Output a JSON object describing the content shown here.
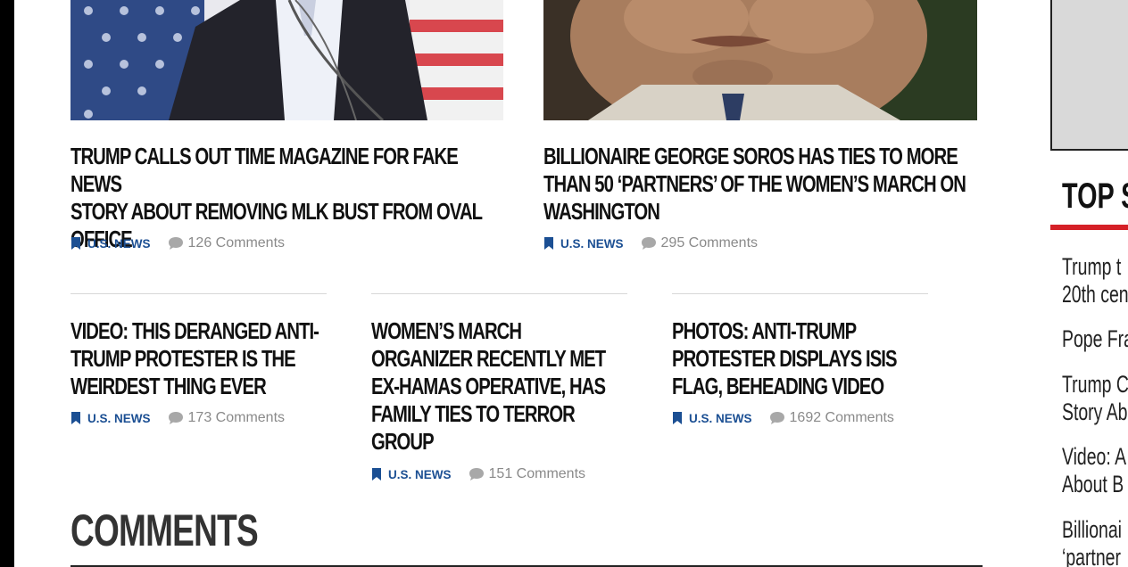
{
  "articles_top": [
    {
      "headline_lines": [
        "TRUMP CALLS OUT TIME MAGAZINE FOR FAKE NEWS",
        "STORY ABOUT REMOVING MLK BUST FROM OVAL",
        "OFFICE"
      ],
      "category": "U.S. NEWS",
      "comments": "126 Comments"
    },
    {
      "headline_lines": [
        "BILLIONAIRE GEORGE SOROS HAS TIES TO MORE",
        "THAN 50 ‘PARTNERS’ OF THE WOMEN’S MARCH ON",
        "WASHINGTON"
      ],
      "category": "U.S. NEWS",
      "comments": "295 Comments"
    }
  ],
  "articles_bottom": [
    {
      "headline_lines": [
        "VIDEO: THIS DERANGED ANTI-",
        "TRUMP PROTESTER IS THE",
        "WEIRDEST THING EVER"
      ],
      "category": "U.S. NEWS",
      "comments": "173 Comments"
    },
    {
      "headline_lines": [
        "WOMEN’S MARCH",
        "ORGANIZER RECENTLY MET",
        "EX-HAMAS OPERATIVE, HAS",
        "FAMILY TIES TO TERROR",
        "GROUP"
      ],
      "category": "U.S. NEWS",
      "comments": "151 Comments"
    },
    {
      "headline_lines": [
        "PHOTOS: ANTI-TRUMP",
        "PROTESTER DISPLAYS ISIS",
        "FLAG, BEHEADING VIDEO"
      ],
      "category": "U.S. NEWS",
      "comments": "1692 Comments"
    }
  ],
  "comments_section": {
    "title": "COMMENTS"
  },
  "sidebar": {
    "title": "TOP S",
    "stories": [
      [
        "Trump t",
        "20th cen"
      ],
      [
        "Pope Fra"
      ],
      [
        "Trump C",
        "Story Ab"
      ],
      [
        "Video: A",
        "About B"
      ],
      [
        "Billionai",
        "‘partner"
      ]
    ]
  },
  "colors": {
    "category_link": "#1b4f93",
    "comment_count": "#8a8a8a",
    "accent_rule": "#d52027"
  },
  "icons": {
    "category": "bookmark-icon",
    "comments": "speech-bubble-icon"
  }
}
